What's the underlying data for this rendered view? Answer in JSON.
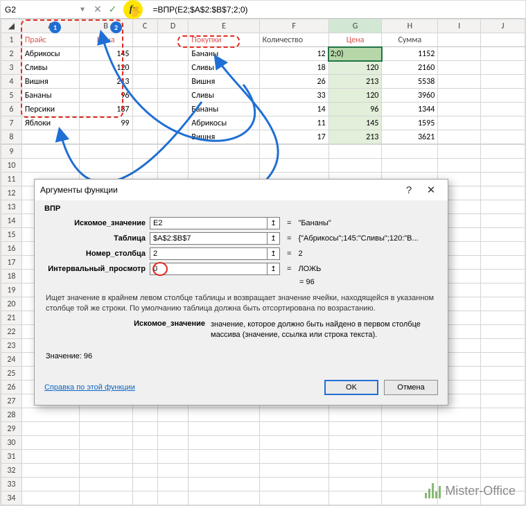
{
  "formula_bar": {
    "name_box": "G2",
    "formula": "=ВПР(E2;$A$2:$B$7;2;0)",
    "fx_label": "fx",
    "cancel_icon": "✕",
    "enter_icon": "✓"
  },
  "col_headers": [
    "A",
    "B",
    "C",
    "D",
    "E",
    "F",
    "G",
    "H",
    "I",
    "J"
  ],
  "row_headers": [
    "1",
    "2",
    "3",
    "4",
    "5",
    "6",
    "7",
    "8",
    "9",
    "10",
    "11",
    "12",
    "13",
    "14",
    "15",
    "16",
    "17",
    "18",
    "19",
    "20",
    "21",
    "22",
    "23",
    "24",
    "25",
    "26",
    "27",
    "28",
    "29",
    "30",
    "31",
    "32",
    "33",
    "34"
  ],
  "price_table": {
    "header": {
      "name": "Прайс",
      "price": "Цена"
    },
    "rows": [
      {
        "name": "Абрикосы",
        "price": "145"
      },
      {
        "name": "Сливы",
        "price": "120"
      },
      {
        "name": "Вишня",
        "price": "213"
      },
      {
        "name": "Бананы",
        "price": "96"
      },
      {
        "name": "Персики",
        "price": "187"
      },
      {
        "name": "Яблоки",
        "price": "99"
      }
    ]
  },
  "shop_table": {
    "header": {
      "buy": "Покупки",
      "qty": "Количество",
      "price": "Цена",
      "sum": "Сумма"
    },
    "rows": [
      {
        "buy": "Бананы",
        "qty": "12",
        "price": "2;0)",
        "sum": "1152"
      },
      {
        "buy": "Сливы",
        "qty": "18",
        "price": "120",
        "sum": "2160"
      },
      {
        "buy": "Вишня",
        "qty": "26",
        "price": "213",
        "sum": "5538"
      },
      {
        "buy": "Сливы",
        "qty": "33",
        "price": "120",
        "sum": "3960"
      },
      {
        "buy": "Бананы",
        "qty": "14",
        "price": "96",
        "sum": "1344"
      },
      {
        "buy": "Абрикосы",
        "qty": "11",
        "price": "145",
        "sum": "1595"
      },
      {
        "buy": "Вишня",
        "qty": "17",
        "price": "213",
        "sum": "3621"
      }
    ]
  },
  "badges": {
    "one": "1",
    "two": "2"
  },
  "dialog": {
    "title": "Аргументы функции",
    "help_icon": "?",
    "close_icon": "✕",
    "function_name": "ВПР",
    "args": {
      "lookup_label": "Искомое_значение",
      "lookup_value": "E2",
      "lookup_eval": "\"Бананы\"",
      "table_label": "Таблица",
      "table_value": "$A$2:$B$7",
      "table_eval": "{\"Абрикосы\";145:\"Сливы\";120:\"В...",
      "col_label": "Номер_столбца",
      "col_value": "2",
      "col_eval": "2",
      "range_label": "Интервальный_просмотр",
      "range_value": "0",
      "range_eval": "ЛОЖЬ",
      "picker_icon": "↥",
      "eq": "="
    },
    "result_eq": "=   96",
    "description": "Ищет значение в крайнем левом столбце таблицы и возвращает значение ячейки, находящейся в указанном столбце той же строки. По умолчанию таблица должна быть отсортирована по возрастанию.",
    "arg_desc_label": "Искомое_значение",
    "arg_desc_text": "значение, которое должно быть найдено в первом столбце массива (значение, ссылка или строка текста).",
    "value_label": "Значение: 96",
    "help_link": "Справка по этой функции",
    "ok": "OK",
    "cancel": "Отмена"
  },
  "watermark": "Mister-Office"
}
